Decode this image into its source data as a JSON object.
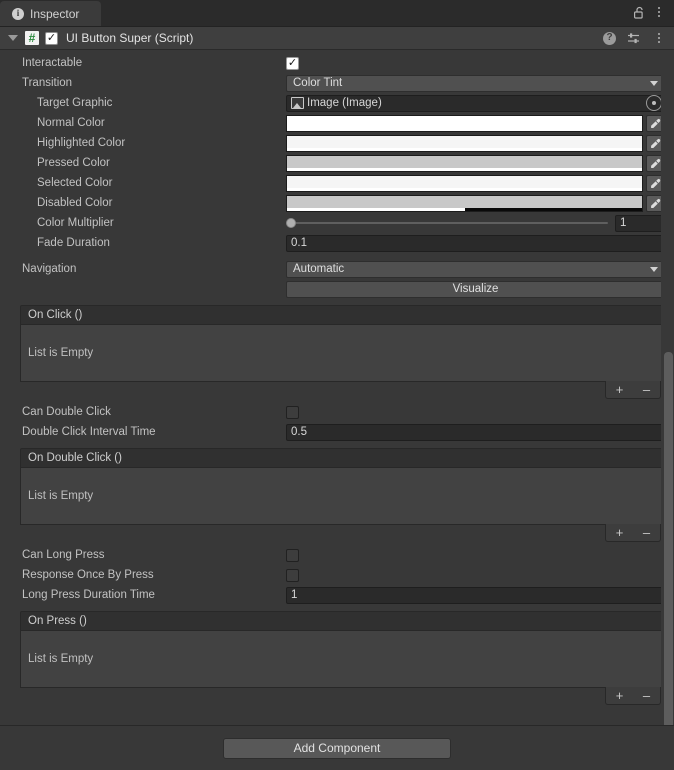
{
  "window": {
    "tab_label": "Inspector",
    "tab_icon": "info-icon",
    "lock_icon": "lock-open-icon",
    "menu_icon": "kebab-menu-icon"
  },
  "component": {
    "title": "UI Button Super (Script)",
    "enabled_checkmark": "✓",
    "script_icon_glyph": "#",
    "foldout_icon": "triangle-down-icon",
    "help_icon": "help-icon",
    "help_glyph": "?",
    "preset_icon": "preset-sliders-icon",
    "menu_icon": "kebab-menu-icon"
  },
  "properties": {
    "interactable": {
      "label": "Interactable",
      "value": "✓",
      "checked": true
    },
    "transition": {
      "label": "Transition",
      "value": "Color Tint"
    },
    "target_graphic": {
      "label": "Target Graphic",
      "value": "Image (Image)",
      "icon": "image-asset-icon"
    },
    "normal_color": {
      "label": "Normal Color",
      "hex": "#FFFFFF",
      "alpha_pct": 100
    },
    "highlighted_color": {
      "label": "Highlighted Color",
      "hex": "#F5F5F5",
      "alpha_pct": 100
    },
    "pressed_color": {
      "label": "Pressed Color",
      "hex": "#C8C8C8",
      "alpha_pct": 100
    },
    "selected_color": {
      "label": "Selected Color",
      "hex": "#F5F5F5",
      "alpha_pct": 100
    },
    "disabled_color": {
      "label": "Disabled Color",
      "hex": "#C8C8C8",
      "alpha_pct": 50
    },
    "color_multiplier": {
      "label": "Color Multiplier",
      "value": "1",
      "slider_pct": 0
    },
    "fade_duration": {
      "label": "Fade Duration",
      "value": "0.1"
    },
    "navigation": {
      "label": "Navigation",
      "value": "Automatic"
    },
    "visualize": {
      "label": "Visualize"
    },
    "can_double_click": {
      "label": "Can Double Click",
      "checked": false
    },
    "double_click_interval_time": {
      "label": "Double Click Interval Time",
      "value": "0.5"
    },
    "can_long_press": {
      "label": "Can Long Press",
      "checked": false
    },
    "response_once_by_press": {
      "label": "Response Once By Press",
      "checked": false
    },
    "long_press_duration_time": {
      "label": "Long Press Duration Time",
      "value": "1"
    }
  },
  "events": {
    "on_click": {
      "header": "On Click ()",
      "empty_text": "List is Empty",
      "add_label": "+",
      "remove_label": "–"
    },
    "on_double_click": {
      "header": "On Double Click ()",
      "empty_text": "List is Empty",
      "add_label": "+",
      "remove_label": "–"
    },
    "on_press": {
      "header": "On Press ()",
      "empty_text": "List is Empty",
      "add_label": "+",
      "remove_label": "–"
    }
  },
  "footer": {
    "add_component_label": "Add Component"
  },
  "colors": {
    "background": "#383838",
    "panel_header": "#3F3F3F",
    "field_dark": "#2A2A2A",
    "control": "#505050",
    "text": "#C2C2C2",
    "accent_script_icon": "#2B8A3E"
  }
}
